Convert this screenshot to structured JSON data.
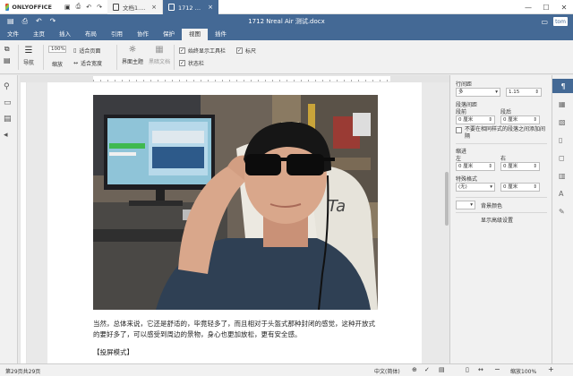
{
  "app": {
    "name": "ONLYOFFICE"
  },
  "tabs": [
    {
      "label": "文档1.docx*",
      "active": false
    },
    {
      "label": "1712 Nreal Air 测试",
      "active": true
    }
  ],
  "document_title": "1712 Nreal Air 测试.docx",
  "user": {
    "initials": "tom"
  },
  "menu": [
    {
      "label": "文件",
      "active": false
    },
    {
      "label": "主页",
      "active": false
    },
    {
      "label": "插入",
      "active": false
    },
    {
      "label": "布局",
      "active": false
    },
    {
      "label": "引用",
      "active": false
    },
    {
      "label": "协作",
      "active": false
    },
    {
      "label": "保护",
      "active": false
    },
    {
      "label": "视图",
      "active": true
    },
    {
      "label": "插件",
      "active": false
    }
  ],
  "ribbon": {
    "navigation": "导航",
    "zoom_value": "100%",
    "zoom_label": "缩放",
    "fit_page": "适合页面",
    "fit_width": "适合宽度",
    "ui_theme": "界面主题",
    "dark_doc": "黑暗文档",
    "always_show_toolbar": "始终显示工具栏",
    "status_bar": "状态栏",
    "ruler": "标尺"
  },
  "content": {
    "paragraph": "当然，总体来说，它还是舒适的，毕竟轻多了，而且相对于头盔式那种封闭的感觉，这种开放式的要好多了，可以感受到周边的景物，身心也更加放松，更有安全感。",
    "caption": "【投屏模式】"
  },
  "right_panel": {
    "line_spacing_label": "行间距",
    "line_spacing_mode": "多",
    "line_spacing_value": "1.15",
    "para_spacing_label": "段落间距",
    "before_label": "段前",
    "after_label": "段后",
    "before_value": "0 厘米",
    "after_value": "0 厘米",
    "no_space_same_style": "不要在相同样式的段落之间添加间隔",
    "indent_label": "缩进",
    "left_label": "左",
    "right_label": "右",
    "left_value": "0 厘米",
    "right_value": "0 厘米",
    "special_label": "特殊格式",
    "special_value": "(无)",
    "special_amount": "0 厘米",
    "bg_color": "背景颜色",
    "advanced": "显示高级设置"
  },
  "status": {
    "page_info": "第29页共29页",
    "language": "中文(简体)",
    "zoom": "缩放100%"
  },
  "colors": {
    "accent": "#446995",
    "ribbon": "#f1f1f1"
  }
}
